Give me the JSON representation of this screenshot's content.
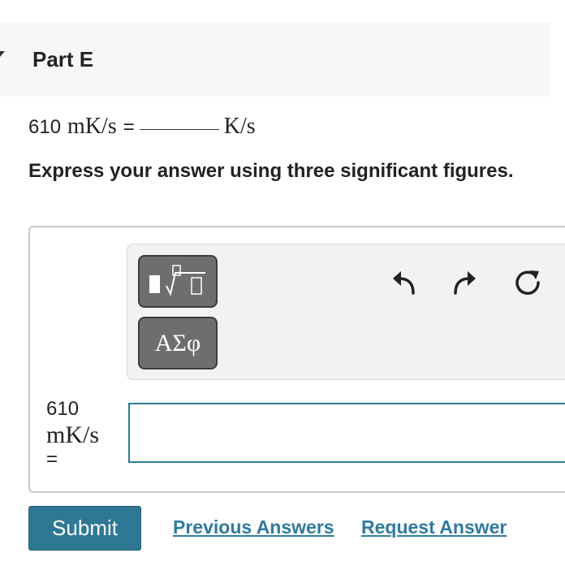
{
  "part": {
    "title": "Part E"
  },
  "question": {
    "value": "610",
    "from_unit": "mK/s",
    "equals": "=",
    "to_unit": "K/s"
  },
  "instruction": "Express your answer using three significant figures.",
  "toolbar": {
    "templates_icon": "fraction-sqrt-templates-icon",
    "symbols_label": "ΑΣφ",
    "undo_icon": "undo-icon",
    "redo_icon": "redo-icon",
    "reset_icon": "reset-icon"
  },
  "answer": {
    "label_value": "610",
    "label_unit": "mK/s",
    "label_equals": "=",
    "input_value": ""
  },
  "actions": {
    "submit": "Submit",
    "previous_answers": "Previous Answers",
    "request_answer": "Request Answer"
  },
  "colors": {
    "header_bg": "#f7f7f7",
    "submit_bg": "#2f7895",
    "link": "#2f7aa0",
    "input_border": "#2b7a9b",
    "tool_button_bg": "#6e6e6e"
  }
}
